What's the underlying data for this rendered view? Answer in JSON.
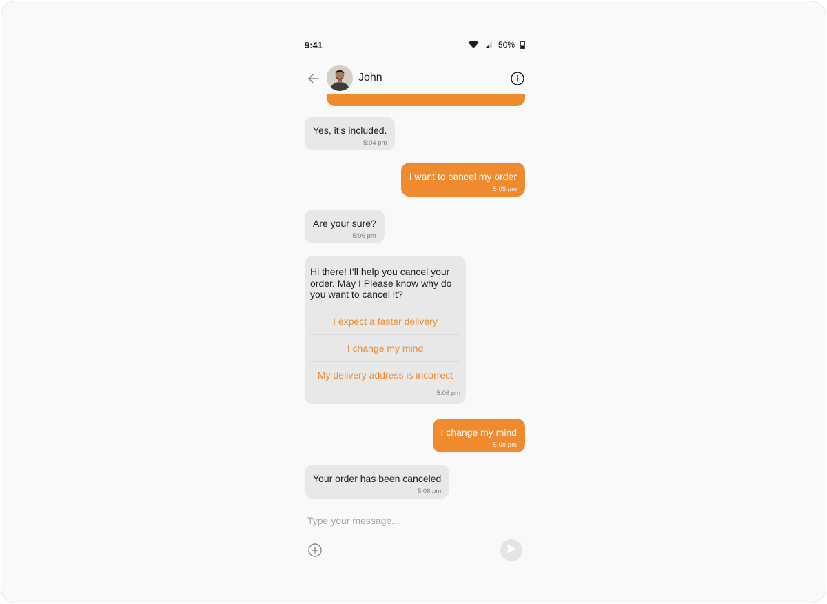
{
  "status_bar": {
    "time": "9:41",
    "battery": "50%",
    "icons": [
      "wifi-icon",
      "signal-icon",
      "battery-icon"
    ]
  },
  "header": {
    "contact_name": "John",
    "icons": [
      "back-arrow-icon",
      "avatar",
      "info-icon"
    ]
  },
  "messages": {
    "m1": {
      "text": "Yes, it’s included.",
      "time": "5:04 pm",
      "direction": "incoming"
    },
    "m2": {
      "text": "I want to cancel my order",
      "time": "5:05 pm",
      "direction": "outgoing"
    },
    "m3": {
      "text": "Are your sure?",
      "time": "5:06 pm",
      "direction": "incoming"
    },
    "m4": {
      "text": "Hi there! I’ll help you cancel your order. May I Please know why do you want to cancel it?",
      "time": "5:06 pm",
      "direction": "incoming",
      "options": [
        "I expect a faster delivery",
        "I change my mind",
        "My delivery address is incorrect"
      ]
    },
    "m5": {
      "text": "I change my mind",
      "time": "5:08 pm",
      "direction": "outgoing"
    },
    "m6": {
      "text": "Your order has been canceled",
      "time": "5:08 pm",
      "direction": "incoming"
    }
  },
  "composer": {
    "placeholder": "Type your message...",
    "value": "",
    "icons": [
      "add-circle-icon",
      "send-icon"
    ]
  },
  "colors": {
    "accent": "#ef8a2e",
    "incoming_bubble": "#e8e8e8",
    "background": "#f9f9f9"
  }
}
